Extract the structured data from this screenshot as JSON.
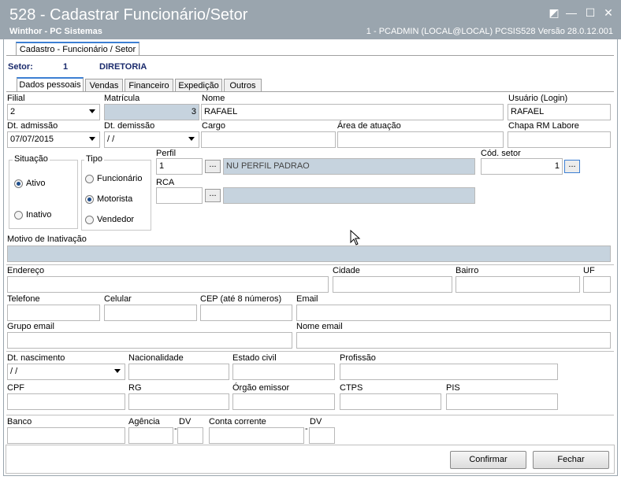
{
  "window": {
    "title": "528 - Cadastrar Funcionário/Setor",
    "subtitle": "Winthor - PC Sistemas",
    "status": "1 - PCADMIN (LOCAL@LOCAL)   PCSIS528  Versão  28.0.12.001",
    "controls": {
      "restore": "◩",
      "minimize": "—",
      "maximize": "☐",
      "close": "✕"
    }
  },
  "top_tab": "Cadastro - Funcionário / Setor",
  "setor": {
    "label": "Setor:",
    "code": "1",
    "name": "DIRETORIA"
  },
  "tabs": [
    "Dados pessoais",
    "Vendas",
    "Financeiro",
    "Expedição",
    "Outros"
  ],
  "form": {
    "filial": {
      "label": "Filial",
      "value": "2"
    },
    "matricula": {
      "label": "Matrícula",
      "value": "3"
    },
    "nome": {
      "label": "Nome",
      "value": "RAFAEL"
    },
    "usuario": {
      "label": "Usuário (Login)",
      "value": "RAFAEL"
    },
    "dt_admissao": {
      "label": "Dt. admissão",
      "value": "07/07/2015"
    },
    "dt_demissao": {
      "label": "Dt.  demissão",
      "value": " / /"
    },
    "cargo": {
      "label": "Cargo",
      "value": ""
    },
    "area_atuacao": {
      "label": "Área de atuação",
      "value": ""
    },
    "chapa": {
      "label": "Chapa RM Labore",
      "value": ""
    },
    "situacao": {
      "label": "Situação",
      "options": [
        "Ativo",
        "Inativo"
      ],
      "selected": "Ativo"
    },
    "tipo": {
      "label": "Tipo",
      "options": [
        "Funcionário",
        "Motorista",
        "Vendedor"
      ],
      "selected": "Motorista"
    },
    "perfil": {
      "label": "Perfil",
      "code": "1",
      "desc": "NU  PERFIL PADRAO",
      "btn": "..."
    },
    "cod_setor": {
      "label": "Cód. setor",
      "value": "1",
      "btn": "..."
    },
    "rca": {
      "label": "RCA",
      "code": "",
      "desc": "",
      "btn": "..."
    },
    "motivo": {
      "label": "Motivo de Inativação",
      "value": ""
    },
    "endereco": {
      "label": "Endereço"
    },
    "cidade": {
      "label": "Cidade"
    },
    "bairro": {
      "label": "Bairro"
    },
    "uf": {
      "label": "UF"
    },
    "telefone": {
      "label": "Telefone"
    },
    "celular": {
      "label": "Celular"
    },
    "cep": {
      "label": "CEP (até 8 números)"
    },
    "email": {
      "label": "Email"
    },
    "grupo_email": {
      "label": "Grupo email"
    },
    "nome_email": {
      "label": "Nome email"
    },
    "dt_nascimento": {
      "label": "Dt. nascimento",
      "value": " / /"
    },
    "nacionalidade": {
      "label": "Nacionalidade"
    },
    "estado_civil": {
      "label": "Estado civil"
    },
    "profissao": {
      "label": "Profissão"
    },
    "cpf": {
      "label": "CPF"
    },
    "rg": {
      "label": "RG"
    },
    "orgao_emissor": {
      "label": "Órgão emissor"
    },
    "ctps": {
      "label": "CTPS"
    },
    "pis": {
      "label": "PIS"
    },
    "banco": {
      "label": "Banco"
    },
    "agencia": {
      "label": "Agência"
    },
    "dv1": {
      "label": "DV"
    },
    "dash": "-",
    "conta_corrente": {
      "label": "Conta corrente"
    },
    "dv2": {
      "label": "DV"
    }
  },
  "buttons": {
    "confirmar": "Confirmar",
    "fechar": "Fechar"
  }
}
